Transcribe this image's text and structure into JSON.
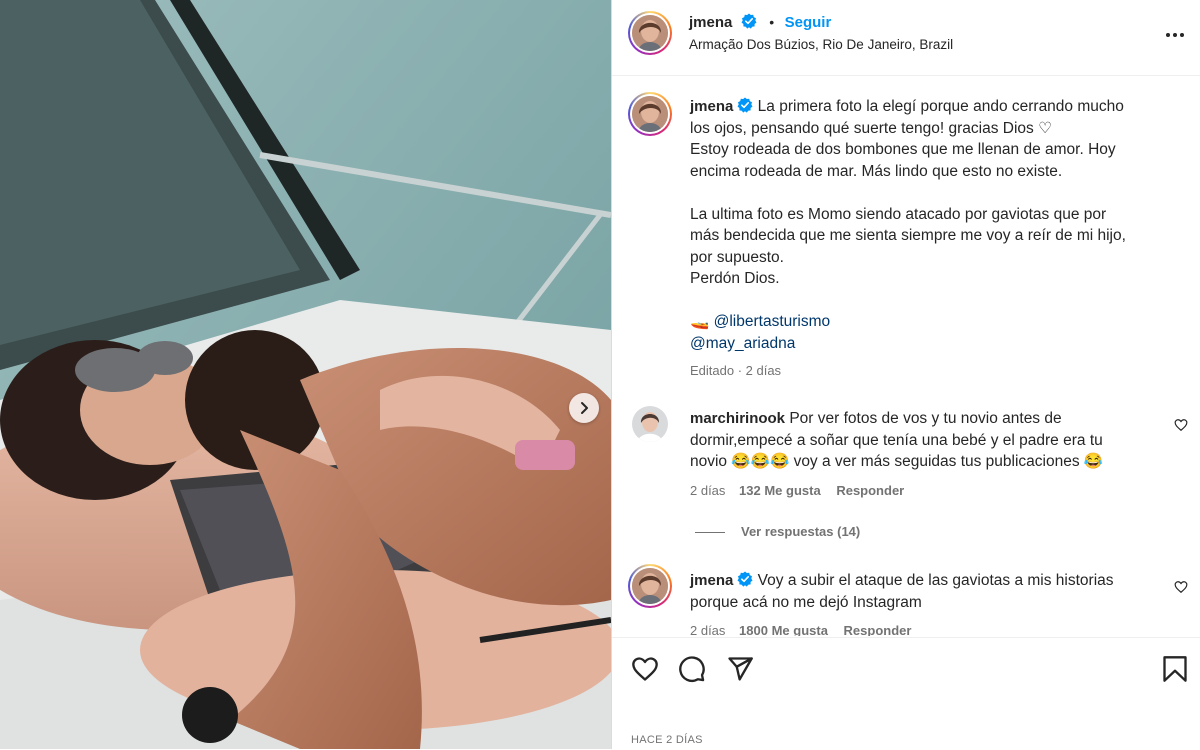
{
  "post": {
    "author": "jmena",
    "follow_label": "Seguir",
    "separator": "•",
    "location": "Armação Dos Búzios, Rio De Janeiro, Brazil",
    "caption": {
      "line1": "La primera foto la elegí porque ando cerrando mucho",
      "line2": "los ojos, pensando qué suerte tengo! gracias Dios ♡",
      "line3": "Estoy rodeada de dos bombones que me llenan de amor. Hoy",
      "line4": "encima rodeada de mar. Más lindo que esto no existe.",
      "line5": "La ultima foto es Momo siendo atacado por gaviotas que por",
      "line6": "más bendecida que me sienta siempre me voy a reír de mi hijo,",
      "line7": "por supuesto.",
      "line8": "Perdón Dios.",
      "boat_emoji": "🚤",
      "mention1": "@libertasturismo",
      "mention2": "@may_ariadna"
    },
    "caption_meta": "Editado · 2 días",
    "date_label": "HACE 2 DÍAS"
  },
  "comments": [
    {
      "user": "marchirinook",
      "line1": "Por ver fotos de vos y tu novio antes de",
      "line2": "dormir,empecé a soñar que tenía una bebé y el padre era tu",
      "line3_a": "novio 😂😂😂 voy a ver más seguidas tus publicaciones 😂",
      "age": "2 días",
      "likes": "132 Me gusta",
      "reply": "Responder",
      "view_replies": "Ver respuestas (14)"
    },
    {
      "user": "jmena",
      "line1": "Voy a subir el ataque de las gaviotas a mis historias",
      "line2": "porque acá no me dejó Instagram",
      "age": "2 días",
      "likes": "1800 Me gusta",
      "reply": "Responder"
    }
  ],
  "icons": {
    "like": "heart-icon",
    "comment": "comment-icon",
    "share": "paper-plane-icon",
    "save": "bookmark-icon",
    "more": "more-options-icon",
    "verified": "verified-badge-icon",
    "next": "chevron-right-icon"
  },
  "colors": {
    "link": "#0095f6",
    "mention": "#00376b",
    "muted": "#737373",
    "text": "#262626"
  }
}
